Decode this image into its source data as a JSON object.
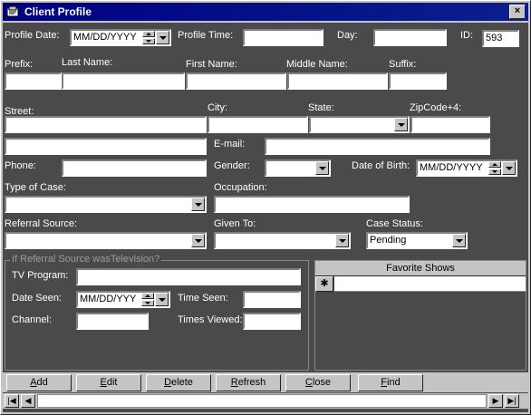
{
  "window": {
    "title": "Client Profile",
    "close": "×"
  },
  "labels": {
    "profile_date": "Profile Date:",
    "profile_time": "Profile Time:",
    "day": "Day:",
    "id": "ID:",
    "prefix": "Prefix:",
    "last_name": "Last Name:",
    "first_name": "First Name:",
    "middle_name": "Middle Name:",
    "suffix": "Suffix:",
    "street": "Street:",
    "city": "City:",
    "state": "State:",
    "zip": "ZipCode+4:",
    "email": "E-mail:",
    "phone": "Phone:",
    "gender": "Gender:",
    "dob": "Date of Birth:",
    "type_of_case": "Type of Case:",
    "occupation": "Occupation:",
    "referral_source": "Referral Source:",
    "given_to": "Given To:",
    "case_status": "Case Status:",
    "tv_group": "If Referral Source wasTelevision?",
    "tv_program": "TV Program:",
    "date_seen": "Date Seen:",
    "time_seen": "Time Seen:",
    "channel": "Channel:",
    "times_viewed": "Times Viewed:",
    "favorite_shows": "Favorite Shows"
  },
  "values": {
    "profile_date": "MM/DD/YYYY",
    "id": "593",
    "dob": "MM/DD/YYYY",
    "case_status": "Pending",
    "date_seen": "MM/DD/YYY",
    "new_row_marker": "✱"
  },
  "buttons": [
    {
      "pre": "",
      "key": "A",
      "post": "dd"
    },
    {
      "pre": "",
      "key": "E",
      "post": "dit"
    },
    {
      "pre": "",
      "key": "D",
      "post": "elete"
    },
    {
      "pre": "",
      "key": "R",
      "post": "efresh"
    },
    {
      "pre": "",
      "key": "C",
      "post": "lose"
    },
    {
      "pre": "",
      "key": "F",
      "post": "ind"
    }
  ],
  "nav": {
    "first": "|◀",
    "prev": "◀",
    "next": "▶",
    "last": "▶|"
  }
}
